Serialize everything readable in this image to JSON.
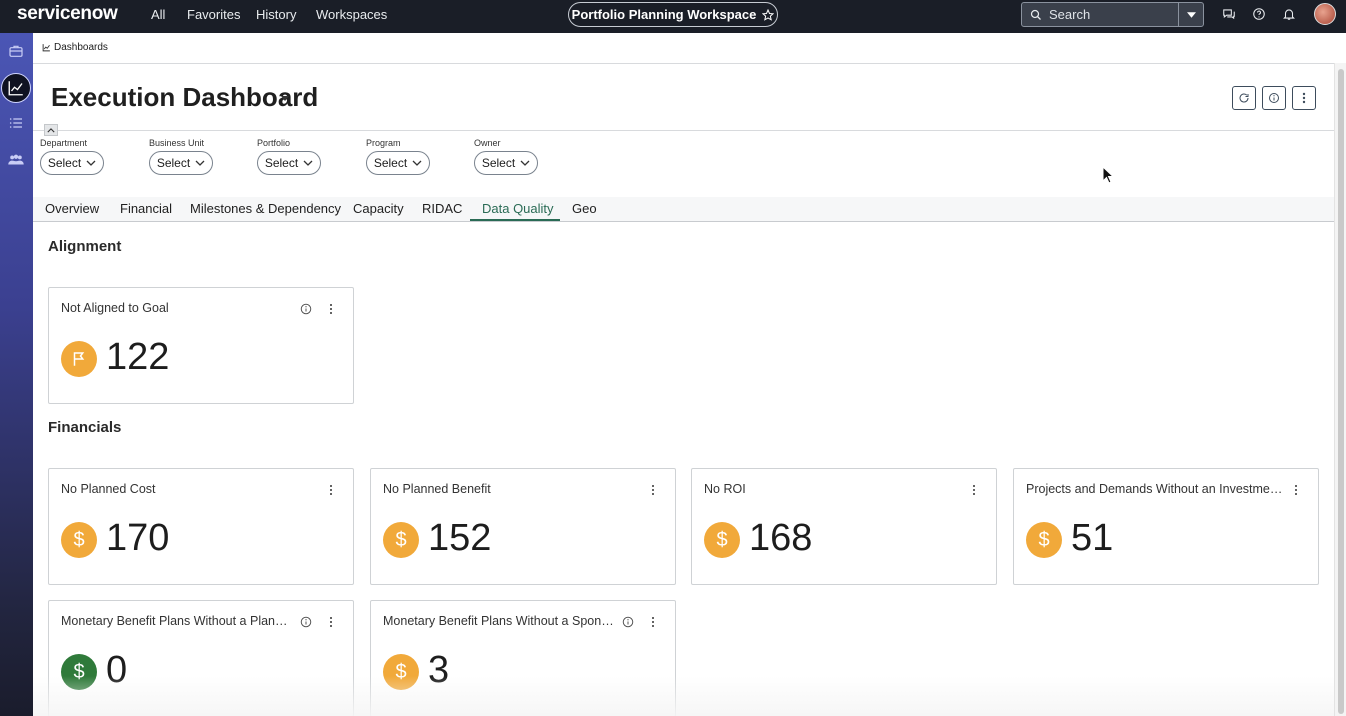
{
  "topbar": {
    "logo": "servicenow",
    "nav": [
      "All",
      "Favorites",
      "History",
      "Workspaces"
    ],
    "workspace": "Portfolio Planning Workspace",
    "search_placeholder": "Search"
  },
  "breadcrumb": "Dashboards",
  "dashboard": {
    "title": "Execution Dashboard"
  },
  "filters": [
    {
      "label": "Department",
      "value": "Select"
    },
    {
      "label": "Business Unit",
      "value": "Select"
    },
    {
      "label": "Portfolio",
      "value": "Select"
    },
    {
      "label": "Program",
      "value": "Select"
    },
    {
      "label": "Owner",
      "value": "Select"
    }
  ],
  "tabs": [
    "Overview",
    "Financial",
    "Milestones & Dependency",
    "Capacity",
    "RIDAC",
    "Data Quality",
    "Geo"
  ],
  "active_tab": "Data Quality",
  "sections": {
    "alignment": "Alignment",
    "financials": "Financials"
  },
  "cards": [
    {
      "title": "Not Aligned to Goal",
      "value": "122",
      "icon": "flag-icon",
      "color": "#f1a93a",
      "info": true
    },
    {
      "title": "No Planned Cost",
      "value": "170",
      "icon": "dollar-icon",
      "color": "#f1a93a",
      "info": false
    },
    {
      "title": "No Planned Benefit",
      "value": "152",
      "icon": "dollar-icon",
      "color": "#f1a93a",
      "info": false
    },
    {
      "title": "No ROI",
      "value": "168",
      "icon": "dollar-icon",
      "color": "#f1a93a",
      "info": false
    },
    {
      "title": "Projects and Demands Without an Investment ...",
      "value": "51",
      "icon": "dollar-icon",
      "color": "#f1a93a",
      "info": false
    },
    {
      "title": "Monetary Benefit Plans Without a Planne...",
      "value": "0",
      "icon": "dollar-icon",
      "color": "#2f7a3a",
      "info": true
    },
    {
      "title": "Monetary Benefit Plans Without a Sponsor",
      "value": "3",
      "icon": "dollar-icon",
      "color": "#f1a93a",
      "info": true
    }
  ]
}
